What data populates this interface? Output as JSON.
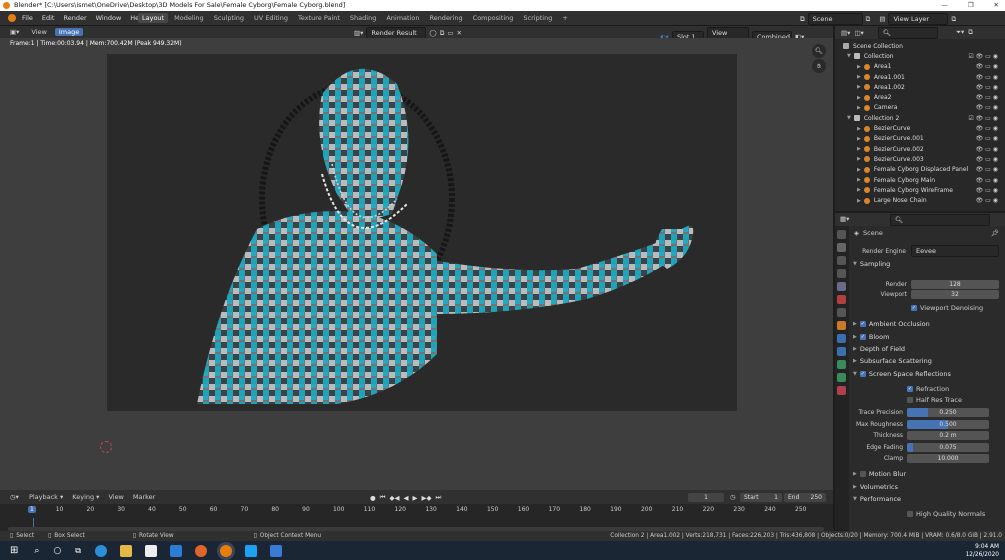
{
  "window": {
    "title": "Blender* [C:\\Users\\ismet\\OneDrive\\Desktop\\3D Models For Sale\\Female Cyborg\\Female Cyborg.blend]"
  },
  "menu": [
    "File",
    "Edit",
    "Render",
    "Window",
    "Help"
  ],
  "workspaces": [
    {
      "label": "Layout",
      "active": true
    },
    {
      "label": "Modeling"
    },
    {
      "label": "Sculpting"
    },
    {
      "label": "UV Editing"
    },
    {
      "label": "Texture Paint"
    },
    {
      "label": "Shading"
    },
    {
      "label": "Animation"
    },
    {
      "label": "Rendering"
    },
    {
      "label": "Compositing"
    },
    {
      "label": "Scripting"
    },
    {
      "label": "+"
    }
  ],
  "scene_selector": "Scene",
  "viewlayer_selector": "View Layer",
  "image_editor": {
    "view": "View",
    "image": "Image",
    "image_name": "Render Result",
    "slot": "Slot 1",
    "view_layer": "View Layer",
    "pass": "Combined",
    "frame_info": "Frame:1 | Time:00:03.94 | Mem:700.42M (Peak 949.32M)"
  },
  "outliner": {
    "root": "Scene Collection",
    "collections": [
      {
        "name": "Collection",
        "items": [
          "Area1",
          "Area1.001",
          "Area1.002",
          "Area2",
          "Camera"
        ]
      },
      {
        "name": "Collection 2",
        "items": [
          "BezierCurve",
          "BezierCurve.001",
          "BezierCurve.002",
          "BezierCurve.003",
          "Female Cyborg Displaced Panel",
          "Female Cyborg Main",
          "Female Cyborg WireFrame",
          "Large Nose Chain"
        ]
      }
    ]
  },
  "properties": {
    "scene": "Scene",
    "render_engine_label": "Render Engine",
    "render_engine": "Eevee",
    "sampling": {
      "label": "Sampling",
      "render_label": "Render",
      "render": "128",
      "viewport_label": "Viewport",
      "viewport": "32",
      "denoise": "Viewport Denoising"
    },
    "sections": [
      {
        "label": "Ambient Occlusion",
        "checked": true
      },
      {
        "label": "Bloom",
        "checked": true
      },
      {
        "label": "Depth of Field",
        "checked": null
      },
      {
        "label": "Subsurface Scattering",
        "checked": null
      },
      {
        "label": "Screen Space Reflections",
        "checked": true,
        "open": true
      }
    ],
    "ssr": {
      "refraction": "Refraction",
      "half_res": "Half Res Trace",
      "fields": [
        {
          "label": "Trace Precision",
          "value": "0.250",
          "fill": 0.25
        },
        {
          "label": "Max Roughness",
          "value": "0.500",
          "fill": 0.5
        },
        {
          "label": "Thickness",
          "value": "0.2 m",
          "fill": 0
        },
        {
          "label": "Edge Fading",
          "value": "0.075",
          "fill": 0.075
        },
        {
          "label": "Clamp",
          "value": "10.000",
          "fill": 0
        }
      ]
    },
    "more_sections": [
      {
        "label": "Motion Blur",
        "checked": false
      },
      {
        "label": "Volumetrics",
        "checked": null
      },
      {
        "label": "Performance",
        "checked": null,
        "open": true
      }
    ],
    "high_quality_normals": "High Quality Normals"
  },
  "timeline": {
    "menu": [
      "Playback",
      "Keying",
      "View",
      "Marker"
    ],
    "current_frame": "1",
    "start_label": "Start",
    "start": "1",
    "end_label": "End",
    "end": "250",
    "ticks": [
      "1",
      "10",
      "20",
      "30",
      "40",
      "50",
      "60",
      "70",
      "80",
      "90",
      "100",
      "110",
      "120",
      "130",
      "140",
      "150",
      "160",
      "170",
      "180",
      "190",
      "200",
      "210",
      "220",
      "230",
      "240",
      "250"
    ]
  },
  "statusbar": {
    "select": "Select",
    "box_select": "Box Select",
    "rotate_view": "Rotate View",
    "context_menu": "Object Context Menu",
    "stats": "Collection 2 | Area1.002 | Verts:218,731 | Faces:226,203 | Tris:436,808 | Objects:0/20 | Memory: 700.4 MiB | VRAM: 0.6/8.0 GiB | 2.91.0"
  },
  "taskbar": {
    "time": "9:04 AM",
    "date": "12/26/2020"
  },
  "colors": {
    "accent": "#4772b3",
    "cyan": "#1fa3b8",
    "active_ws": "#474747"
  }
}
